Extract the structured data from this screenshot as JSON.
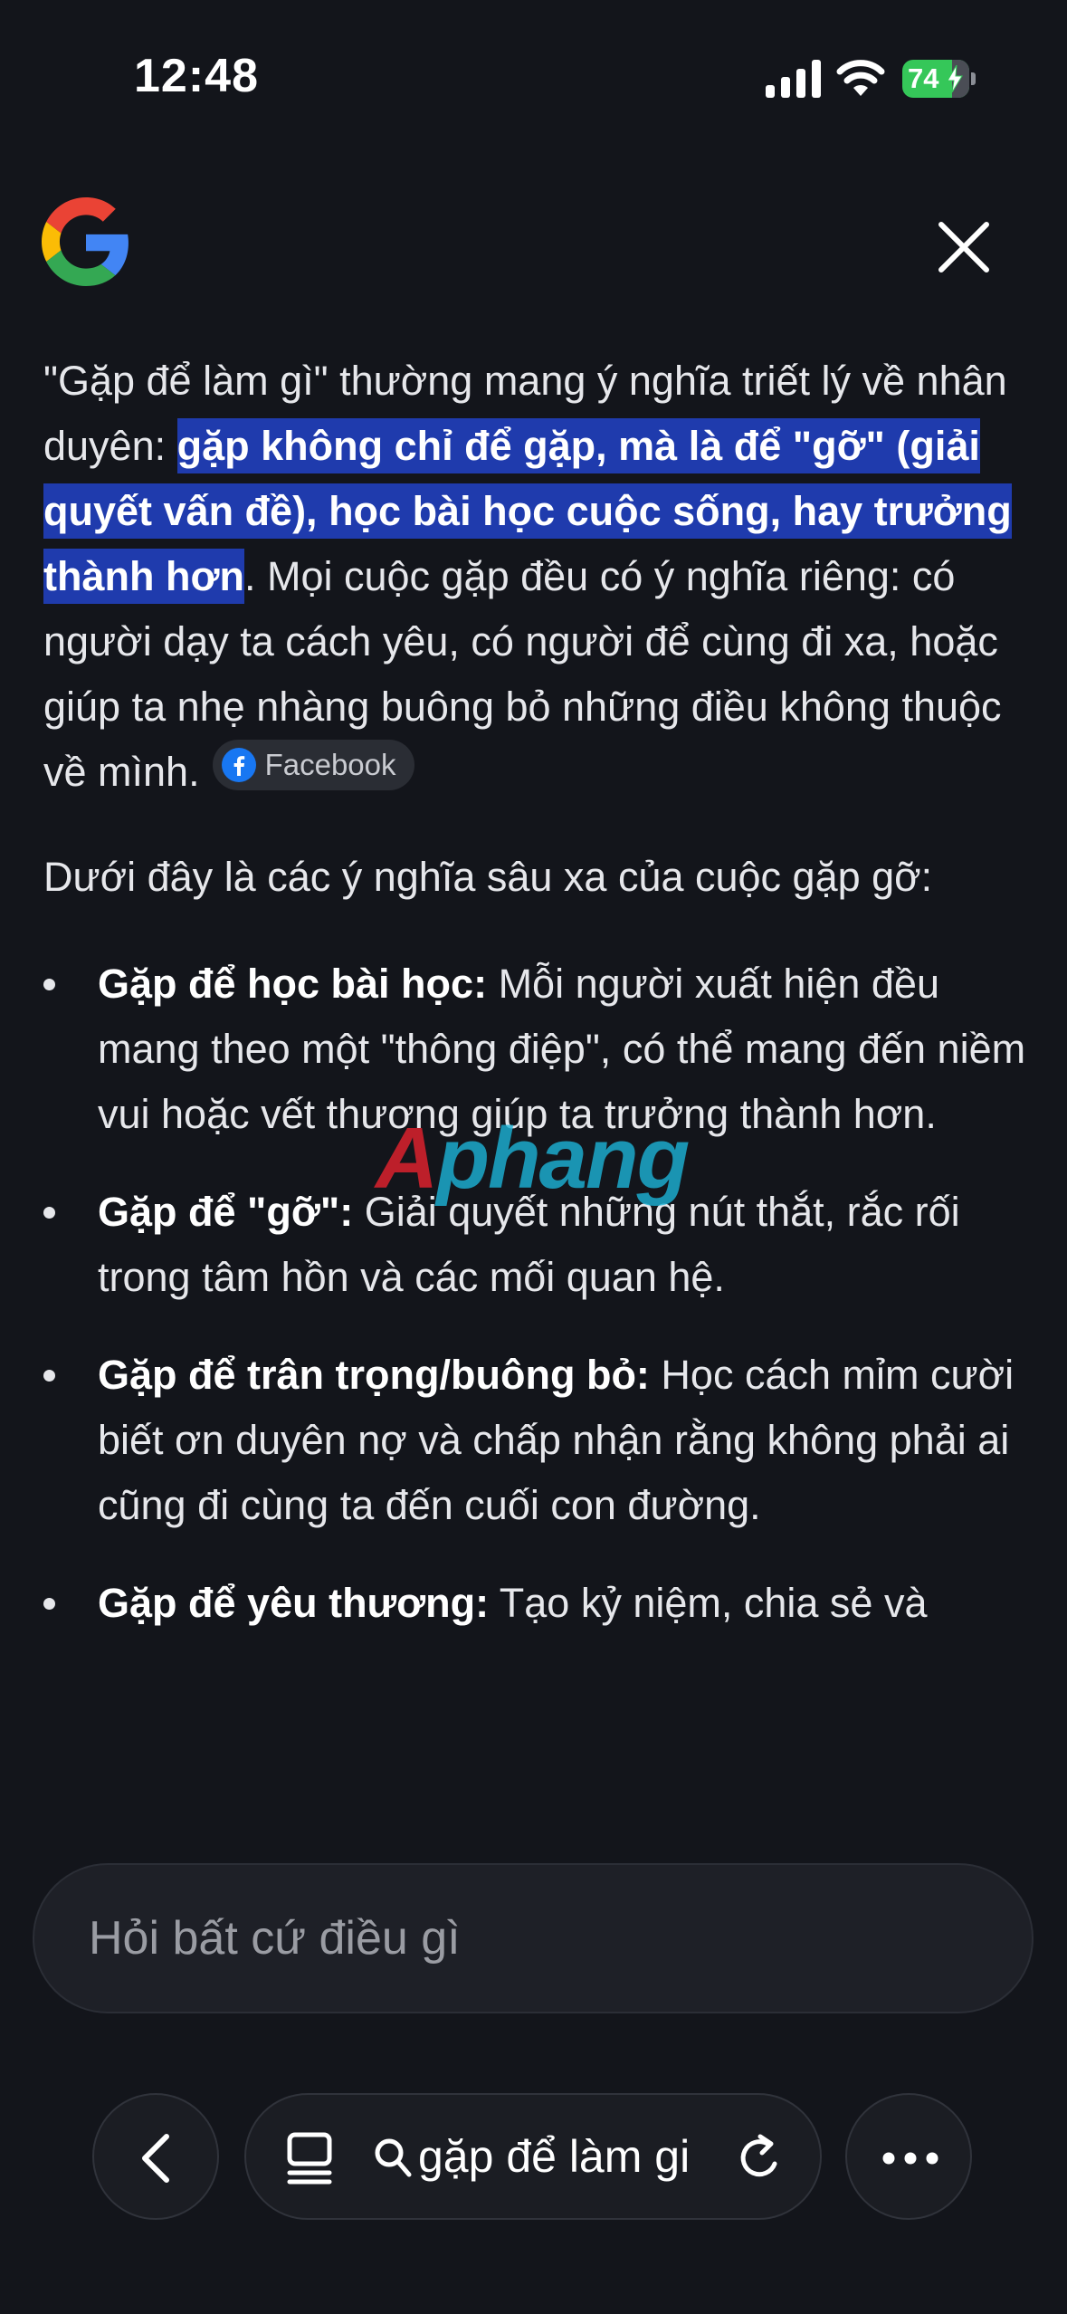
{
  "status_bar": {
    "time": "12:48",
    "battery_level": "74",
    "battery_fraction": 0.74,
    "battery_color": "#35c759",
    "icons": [
      "signal-icon",
      "wifi-icon",
      "battery-icon",
      "charging-bolt-icon"
    ]
  },
  "header": {
    "logo": "google-logo",
    "close_icon": "close-icon"
  },
  "answer": {
    "intro_before": "\"Gặp để làm gì\" thường mang ý nghĩa triết lý về nhân duyên: ",
    "intro_highlight": "gặp không chỉ để gặp, mà là để \"gỡ\" (giải quyết vấn đề), học bài học cuộc sống, hay trưởng thành hơn",
    "intro_after": ". Mọi cuộc gặp đều có ý nghĩa riêng: có người dạy ta cách yêu, có người để cùng đi xa, hoặc giúp ta nhẹ nhàng buông bỏ những điều không thuộc về mình.",
    "source_chip": "Facebook",
    "highlight_color": "#1f3bad",
    "lead_in": "Dưới đây là các ý nghĩa sâu xa của cuộc gặp gỡ:",
    "bullets": [
      {
        "title": "Gặp để học bài học:",
        "text": " Mỗi người xuất hiện đều mang theo một \"thông điệp\", có thể mang đến niềm vui hoặc vết thương giúp ta trưởng thành hơn."
      },
      {
        "title": "Gặp để \"gỡ\":",
        "text": " Giải quyết những nút thắt, rắc rối trong tâm hồn và các mối quan hệ."
      },
      {
        "title": "Gặp để trân trọng/buông bỏ:",
        "text": " Học cách mỉm cười biết ơn duyên nợ và chấp nhận rằng không phải ai cũng đi cùng ta đến cuối con đường."
      },
      {
        "title": "Gặp để yêu thương:",
        "text": " Tạo kỷ niệm, chia sẻ và"
      }
    ]
  },
  "watermark": {
    "first": "A",
    "rest": "phang"
  },
  "input": {
    "placeholder": "Hỏi bất cứ điều gì"
  },
  "nav": {
    "query": "gặp để làm gi",
    "icons": [
      "back-icon",
      "tabs-icon",
      "search-icon",
      "reload-icon",
      "more-icon"
    ]
  }
}
